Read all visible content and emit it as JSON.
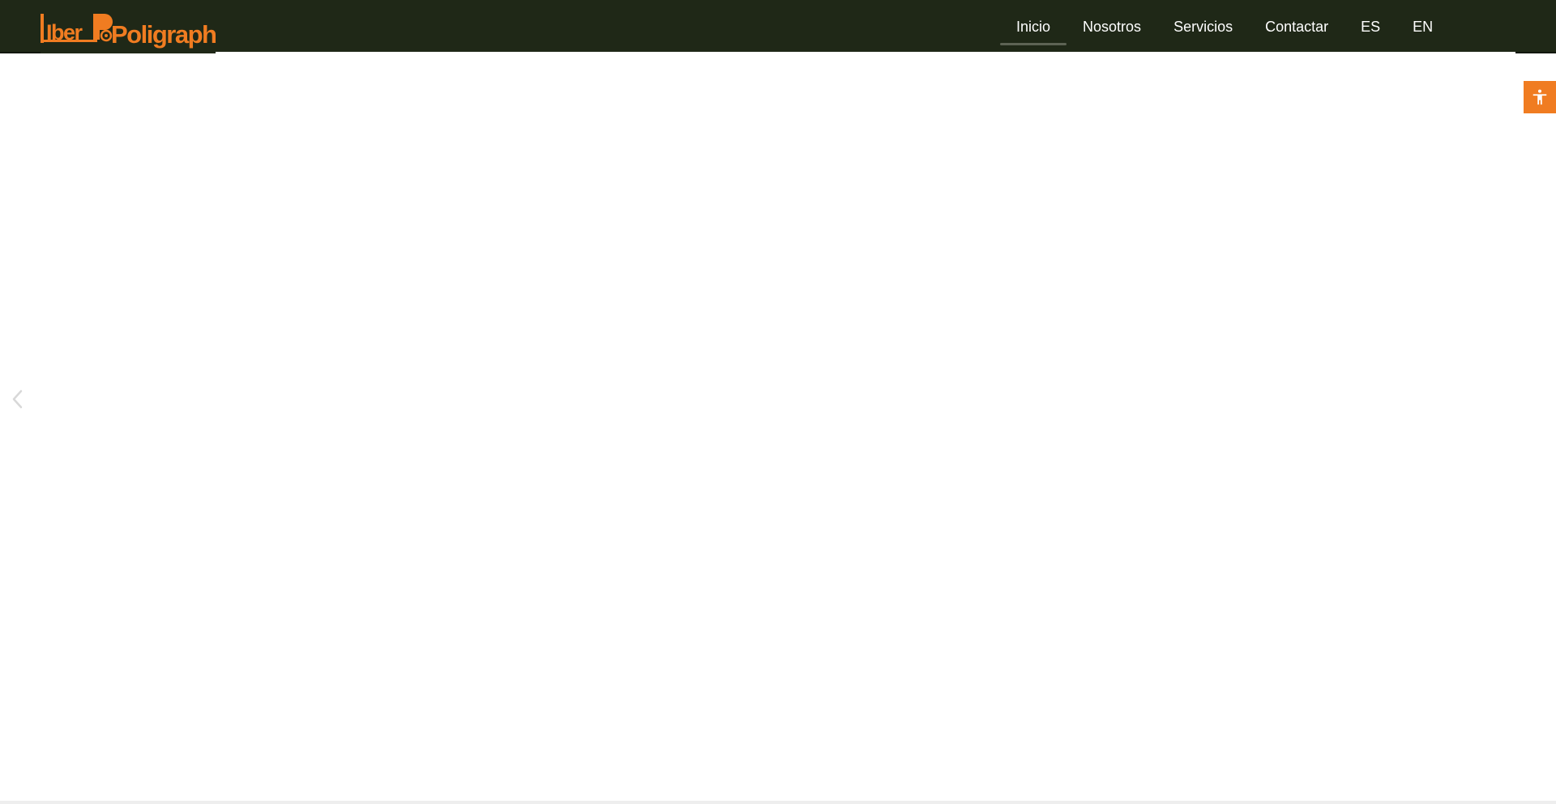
{
  "brand": {
    "logo_text_a": "Iber",
    "logo_text_b": "Poligraph",
    "accent_color": "#f07c21",
    "header_color": "#1f2817"
  },
  "nav": {
    "items": [
      {
        "label": "Inicio",
        "active": true
      },
      {
        "label": "Nosotros",
        "active": false
      },
      {
        "label": "Servicios",
        "active": false
      },
      {
        "label": "Contactar",
        "active": false
      },
      {
        "label": "ES",
        "active": false
      },
      {
        "label": "EN",
        "active": false
      }
    ]
  },
  "widgets": {
    "accessibility_icon": "accessibility-icon",
    "slider_prev_icon": "chevron-left-icon"
  }
}
